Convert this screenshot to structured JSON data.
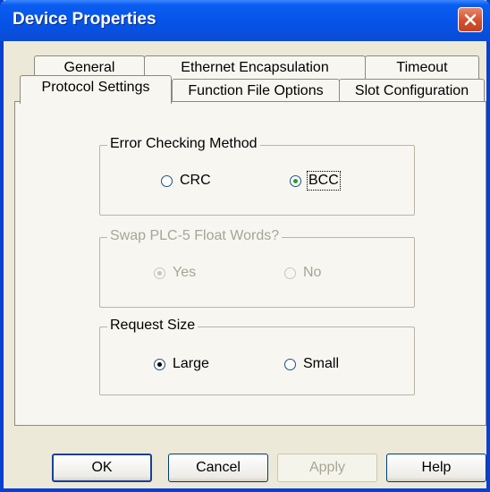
{
  "window": {
    "title": "Device Properties"
  },
  "tabs": {
    "row1": [
      "General",
      "Ethernet Encapsulation",
      "Timeout"
    ],
    "row2": [
      "Protocol Settings",
      "Function File Options",
      "Slot Configuration"
    ]
  },
  "error_checking": {
    "label": "Error Checking Method",
    "options": [
      "CRC",
      "BCC"
    ],
    "selected": "BCC"
  },
  "swap_float": {
    "label": "Swap PLC-5 Float Words?",
    "options": [
      "Yes",
      "No"
    ],
    "selected": "Yes",
    "enabled": false
  },
  "request_size": {
    "label": "Request Size",
    "options": [
      "Large",
      "Small"
    ],
    "selected": "Large"
  },
  "buttons": {
    "ok": "OK",
    "cancel": "Cancel",
    "apply": "Apply",
    "help": "Help"
  }
}
